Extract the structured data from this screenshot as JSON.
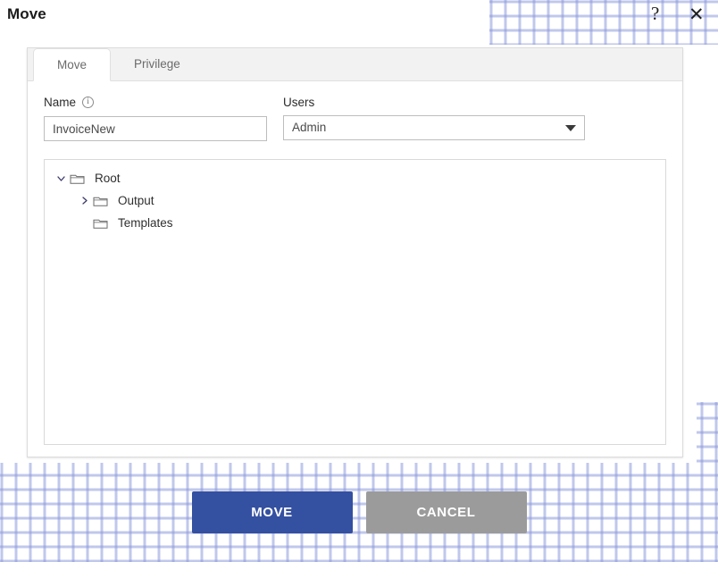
{
  "window": {
    "title": "Move",
    "help_icon": "help-question-icon",
    "help_glyph": "?",
    "close_icon": "close-x-icon",
    "close_glyph": "✕"
  },
  "tabs": [
    {
      "label": "Move",
      "active": true
    },
    {
      "label": "Privilege",
      "active": false
    }
  ],
  "form": {
    "name": {
      "label": "Name",
      "info_icon": "info-circle-icon",
      "info_glyph": "i",
      "value": "InvoiceNew",
      "placeholder": ""
    },
    "users": {
      "label": "Users",
      "selected": "Admin",
      "caret_icon": "chevron-down-icon",
      "options": [
        "Admin"
      ]
    }
  },
  "tree": {
    "nodes": [
      {
        "label": "Root",
        "depth": 0,
        "expanded": true,
        "toggle_icon": "chevron-down-icon",
        "folder_icon": "folder-icon"
      },
      {
        "label": "Output",
        "depth": 1,
        "expanded": false,
        "toggle_icon": "chevron-right-icon",
        "folder_icon": "folder-icon"
      },
      {
        "label": "Templates",
        "depth": 1,
        "expanded": null,
        "toggle_icon": "",
        "folder_icon": "folder-icon"
      }
    ]
  },
  "footer": {
    "primary_label": "MOVE",
    "secondary_label": "CANCEL"
  },
  "colors": {
    "primary_button": "#3450a0",
    "secondary_button": "#9b9b9b",
    "tab_strip": "#f2f2f2",
    "pattern_dot": "#7888d4",
    "border": "#dcdcdc"
  }
}
